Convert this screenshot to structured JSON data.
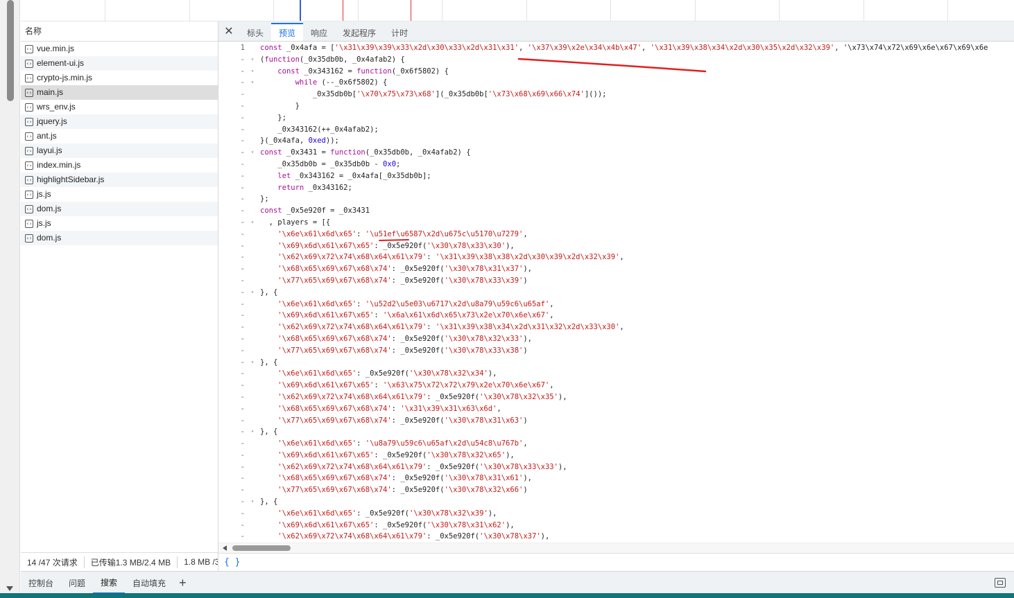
{
  "left_header": "名称",
  "files": [
    "vue.min.js",
    "element-ui.js",
    "crypto-js.min.js",
    "main.js",
    "wrs_env.js",
    "jquery.js",
    "ant.js",
    "layui.js",
    "index.min.js",
    "highlightSidebar.js",
    "js.js",
    "dom.js",
    "js.js",
    "dom.js"
  ],
  "selected_file": "main.js",
  "status": [
    "14 /47 次请求",
    "已传输1.3 MB/2.4 MB",
    "1.8 MB /3"
  ],
  "tabs": [
    "标头",
    "预览",
    "响应",
    "发起程序",
    "计时"
  ],
  "active_tab": "预览",
  "close_icon": "close-icon",
  "code": [
    [
      "1",
      "",
      "const _0x4afa = ['\\x31\\x39\\x39\\x33\\x2d\\x30\\x33\\x2d\\x31\\x31', '\\x37\\x39\\x2e\\x34\\x4b\\x47', '\\x31\\x39\\x38\\x34\\x2d\\x30\\x35\\x2d\\x32\\x39', '\\x73\\x74\\x72\\x69\\x6e\\x67\\x69\\x6e"
    ],
    [
      "-",
      "▾",
      "(function(_0x35db0b, _0x4afab2) {"
    ],
    [
      "-",
      "▾",
      "    const _0x343162 = function(_0x6f5802) {"
    ],
    [
      "-",
      "▾",
      "        while (--_0x6f5802) {"
    ],
    [
      "-",
      "",
      "            _0x35db0b['\\x70\\x75\\x73\\x68'](_0x35db0b['\\x73\\x68\\x69\\x66\\x74']());"
    ],
    [
      "-",
      "",
      "        }"
    ],
    [
      "-",
      "",
      "    };"
    ],
    [
      "-",
      "",
      "    _0x343162(++_0x4afab2);"
    ],
    [
      "-",
      "",
      "}(_0x4afa, 0xed));"
    ],
    [
      "-",
      "▾",
      "const _0x3431 = function(_0x35db0b, _0x4afab2) {"
    ],
    [
      "-",
      "",
      "    _0x35db0b = _0x35db0b - 0x0;"
    ],
    [
      "-",
      "",
      "    let _0x343162 = _0x4afa[_0x35db0b];"
    ],
    [
      "-",
      "",
      "    return _0x343162;"
    ],
    [
      "-",
      "",
      "};"
    ],
    [
      "-",
      "",
      "const _0x5e920f = _0x3431"
    ],
    [
      "-",
      "▾",
      "  , players = [{"
    ],
    [
      "-",
      "",
      "    '\\x6e\\x61\\x6d\\x65': '\\u51ef\\u6587\\x2d\\u675c\\u5170\\u7279',"
    ],
    [
      "-",
      "",
      "    '\\x69\\x6d\\x61\\x67\\x65': _0x5e920f('\\x30\\x78\\x33\\x30'),"
    ],
    [
      "-",
      "",
      "    '\\x62\\x69\\x72\\x74\\x68\\x64\\x61\\x79': '\\x31\\x39\\x38\\x38\\x2d\\x30\\x39\\x2d\\x32\\x39',"
    ],
    [
      "-",
      "",
      "    '\\x68\\x65\\x69\\x67\\x68\\x74': _0x5e920f('\\x30\\x78\\x31\\x37'),"
    ],
    [
      "-",
      "",
      "    '\\x77\\x65\\x69\\x67\\x68\\x74': _0x5e920f('\\x30\\x78\\x33\\x39')"
    ],
    [
      "-",
      "▾",
      "}, {"
    ],
    [
      "-",
      "",
      "    '\\x6e\\x61\\x6d\\x65': '\\u52d2\\u5e03\\u6717\\x2d\\u8a79\\u59c6\\u65af',"
    ],
    [
      "-",
      "",
      "    '\\x69\\x6d\\x61\\x67\\x65': '\\x6a\\x61\\x6d\\x65\\x73\\x2e\\x70\\x6e\\x67',"
    ],
    [
      "-",
      "",
      "    '\\x62\\x69\\x72\\x74\\x68\\x64\\x61\\x79': '\\x31\\x39\\x38\\x34\\x2d\\x31\\x32\\x2d\\x33\\x30',"
    ],
    [
      "-",
      "",
      "    '\\x68\\x65\\x69\\x67\\x68\\x74': _0x5e920f('\\x30\\x78\\x32\\x33'),"
    ],
    [
      "-",
      "",
      "    '\\x77\\x65\\x69\\x67\\x68\\x74': _0x5e920f('\\x30\\x78\\x33\\x38')"
    ],
    [
      "-",
      "▾",
      "}, {"
    ],
    [
      "-",
      "",
      "    '\\x6e\\x61\\x6d\\x65': _0x5e920f('\\x30\\x78\\x32\\x34'),"
    ],
    [
      "-",
      "",
      "    '\\x69\\x6d\\x61\\x67\\x65': '\\x63\\x75\\x72\\x72\\x79\\x2e\\x70\\x6e\\x67',"
    ],
    [
      "-",
      "",
      "    '\\x62\\x69\\x72\\x74\\x68\\x64\\x61\\x79': _0x5e920f('\\x30\\x78\\x32\\x35'),"
    ],
    [
      "-",
      "",
      "    '\\x68\\x65\\x69\\x67\\x68\\x74': '\\x31\\x39\\x31\\x63\\x6d',"
    ],
    [
      "-",
      "",
      "    '\\x77\\x65\\x69\\x67\\x68\\x74': _0x5e920f('\\x30\\x78\\x31\\x63')"
    ],
    [
      "-",
      "▾",
      "}, {"
    ],
    [
      "-",
      "",
      "    '\\x6e\\x61\\x6d\\x65': '\\u8a79\\u59c6\\u65af\\x2d\\u54c8\\u767b',"
    ],
    [
      "-",
      "",
      "    '\\x69\\x6d\\x61\\x67\\x65': _0x5e920f('\\x30\\x78\\x32\\x65'),"
    ],
    [
      "-",
      "",
      "    '\\x62\\x69\\x72\\x74\\x68\\x64\\x61\\x79': _0x5e920f('\\x30\\x78\\x33\\x33'),"
    ],
    [
      "-",
      "",
      "    '\\x68\\x65\\x69\\x67\\x68\\x74': _0x5e920f('\\x30\\x78\\x31\\x61'),"
    ],
    [
      "-",
      "",
      "    '\\x77\\x65\\x69\\x67\\x68\\x74': _0x5e920f('\\x30\\x78\\x32\\x66')"
    ],
    [
      "-",
      "▾",
      "}, {"
    ],
    [
      "-",
      "",
      "    '\\x6e\\x61\\x6d\\x65': _0x5e920f('\\x30\\x78\\x32\\x39'),"
    ],
    [
      "-",
      "",
      "    '\\x69\\x6d\\x61\\x67\\x65': _0x5e920f('\\x30\\x78\\x31\\x62'),"
    ],
    [
      "-",
      "",
      "    '\\x62\\x69\\x72\\x74\\x68\\x64\\x61\\x79': _0x5e920f('\\x30\\x78\\x37'),"
    ]
  ],
  "braces": "{ }",
  "drawer_tabs": [
    "控制台",
    "问题",
    "搜索",
    "自动填充"
  ],
  "active_drawer_tab": "搜索",
  "plus_label": "+",
  "colors": {
    "accent": "#1a73e8",
    "string": "#c41a16",
    "keyword": "#aa0d91",
    "number": "#1c00cf",
    "annotation": "#e02020"
  }
}
